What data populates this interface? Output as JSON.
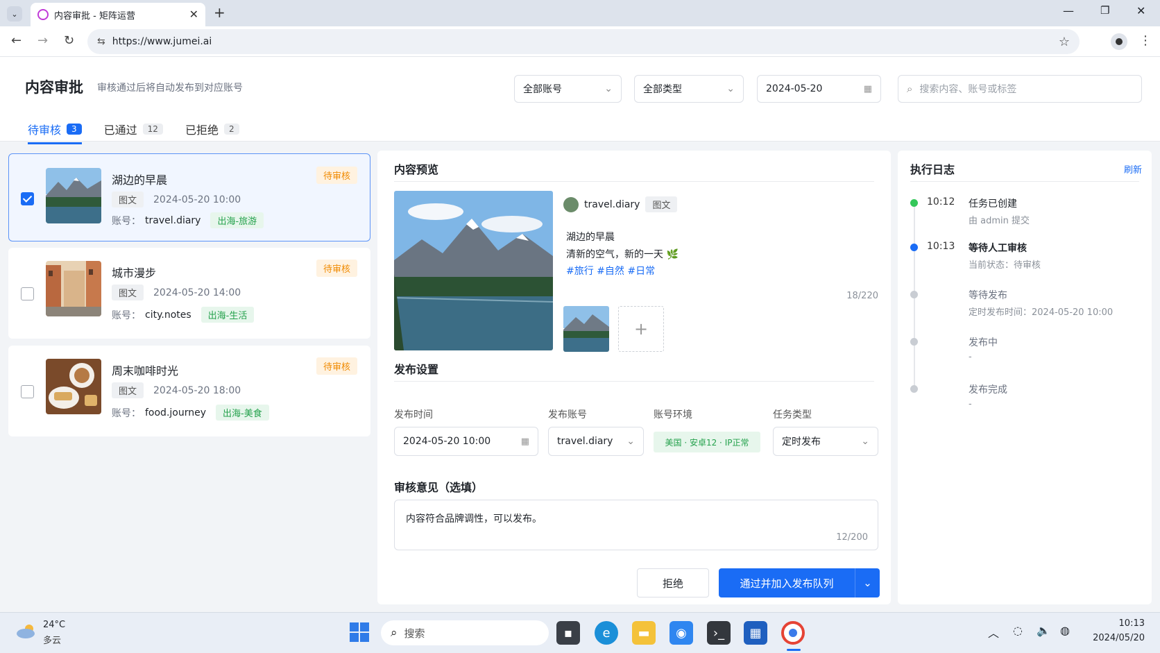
{
  "browser": {
    "tab_title": "内容审批 - 矩阵运营",
    "url": "https://www.jumei.ai"
  },
  "page": {
    "title": "内容审批",
    "subtitle": "审核通过后将自动发布到对应账号",
    "filters": {
      "account": "全部账号",
      "type": "全部类型",
      "date": "2024-05-20",
      "search_placeholder": "搜索内容、账号或标签"
    },
    "tabs": [
      {
        "label": "待审核",
        "count": "3"
      },
      {
        "label": "已通过",
        "count": "12"
      },
      {
        "label": "已拒绝",
        "count": "2"
      }
    ]
  },
  "list": [
    {
      "title": "湖边的早晨",
      "type": "图文",
      "time": "2024-05-20 10:00",
      "account_label": "账号：",
      "account": "travel.diary",
      "tag": "出海-旅游",
      "status": "待审核",
      "checked": true
    },
    {
      "title": "城市漫步",
      "type": "图文",
      "time": "2024-05-20 14:00",
      "account_label": "账号：",
      "account": "city.notes",
      "tag": "出海-生活",
      "status": "待审核",
      "checked": false
    },
    {
      "title": "周末咖啡时光",
      "type": "图文",
      "time": "2024-05-20 18:00",
      "account_label": "账号：",
      "account": "food.journey",
      "tag": "出海-美食",
      "status": "待审核",
      "checked": false
    }
  ],
  "preview": {
    "section_title": "内容预览",
    "account": "travel.diary",
    "type": "图文",
    "post_title": "湖边的早晨",
    "body": "清新的空气，新的一天 🌿",
    "hashtags": "#旅行 #自然 #日常",
    "char_count": "18/220",
    "add_icon": "+"
  },
  "publish": {
    "section_title": "发布设置",
    "time_label": "发布时间",
    "time_value": "2024-05-20 10:00",
    "account_label": "发布账号",
    "account_value": "travel.diary",
    "env_label": "账号环境",
    "env_value": "美国 · 安卓12 · IP正常",
    "task_label": "任务类型",
    "task_value": "定时发布"
  },
  "review": {
    "section_title": "审核意见（选填）",
    "comment": "内容符合品牌调性，可以发布。",
    "char_count": "12/200",
    "reject_label": "拒绝",
    "approve_label": "通过并加入发布队列"
  },
  "log": {
    "title": "执行日志",
    "refresh_label": "刷新",
    "items": [
      {
        "time": "10:12",
        "title": "任务已创建",
        "sub": "由 admin 提交",
        "color": "#34c759"
      },
      {
        "time": "10:13",
        "title": "等待人工审核",
        "sub": "当前状态：待审核",
        "color": "#1a6cf5"
      },
      {
        "time": "",
        "title": "等待发布",
        "sub": "定时发布时间：2024-05-20 10:00",
        "color": "#c9cdd3"
      },
      {
        "time": "",
        "title": "发布中",
        "sub": "-",
        "color": "#c9cdd3"
      },
      {
        "time": "",
        "title": "发布完成",
        "sub": "-",
        "color": "#c9cdd3"
      }
    ]
  },
  "taskbar": {
    "weather_temp": "24°C",
    "weather_desc": "多云",
    "search_label": "搜索",
    "clock_time": "10:13",
    "clock_date": "2024/05/20"
  },
  "colors": {
    "accent": "#1a6cf5",
    "pending": "#f08a00",
    "tag_green": "#24a14c"
  }
}
